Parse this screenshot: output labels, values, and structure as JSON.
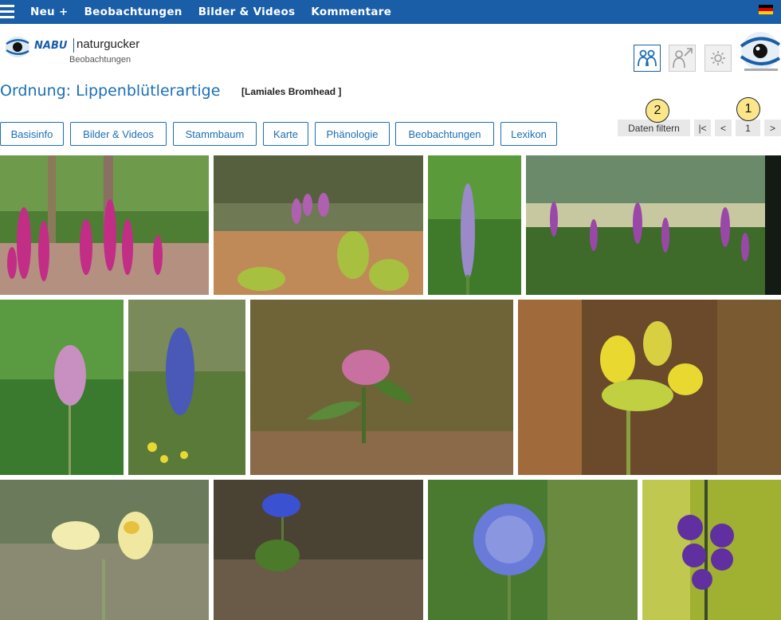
{
  "topbar": {
    "nav": [
      "Neu +",
      "Beobachtungen",
      "Bilder & Videos",
      "Kommentare"
    ],
    "flag_colors": [
      "#000000",
      "#dd0000",
      "#ffce00"
    ]
  },
  "logo": {
    "nabu": "NABU",
    "brand": "naturgucker",
    "sub": "Beobachtungen"
  },
  "header_icons": [
    "community-icon",
    "share-profile-icon",
    "settings-sun-icon"
  ],
  "page": {
    "title": "Ordnung: Lippenblütlerartige",
    "subtitle": "[Lamiales Bromhead ]"
  },
  "tabs": [
    "Basisinfo",
    "Bilder & Videos",
    "Stammbaum",
    "Karte",
    "Phänologie",
    "Beobachtungen",
    "Lexikon"
  ],
  "filter": {
    "label": "Daten filtern"
  },
  "pagination": {
    "first": "|<",
    "prev": "<",
    "page": "1",
    "next": ">"
  },
  "badges": [
    "1",
    "2"
  ],
  "gallery": [
    {
      "subject": "foxglove-meadow",
      "colors": [
        "#5a8a3a",
        "#c23a8a"
      ]
    },
    {
      "subject": "foxglove-clearing",
      "colors": [
        "#7a8a5a",
        "#a050a0"
      ]
    },
    {
      "subject": "veronica-spike",
      "colors": [
        "#3c7a28",
        "#9a8ac8"
      ]
    },
    {
      "subject": "foxglove-forest",
      "colors": [
        "#2a4a2a",
        "#9040a0"
      ]
    },
    {
      "subject": "plantain-flower",
      "colors": [
        "#3a7a30",
        "#c890c0"
      ]
    },
    {
      "subject": "bugle-flower",
      "colors": [
        "#5a8040",
        "#4a5ab8"
      ]
    },
    {
      "subject": "deadnettle",
      "colors": [
        "#7a6a3a",
        "#c870a0"
      ]
    },
    {
      "subject": "yellow-rattle",
      "colors": [
        "#6a5030",
        "#e8d830"
      ]
    },
    {
      "subject": "toadflax",
      "colors": [
        "#8a8a70",
        "#f0e8a0"
      ]
    },
    {
      "subject": "speedwell-blue",
      "colors": [
        "#4a4030",
        "#3a50d0"
      ]
    },
    {
      "subject": "globularia",
      "colors": [
        "#4a7030",
        "#6a7ad8"
      ]
    },
    {
      "subject": "purple-mullein",
      "colors": [
        "#a0b030",
        "#6030a0"
      ]
    }
  ]
}
